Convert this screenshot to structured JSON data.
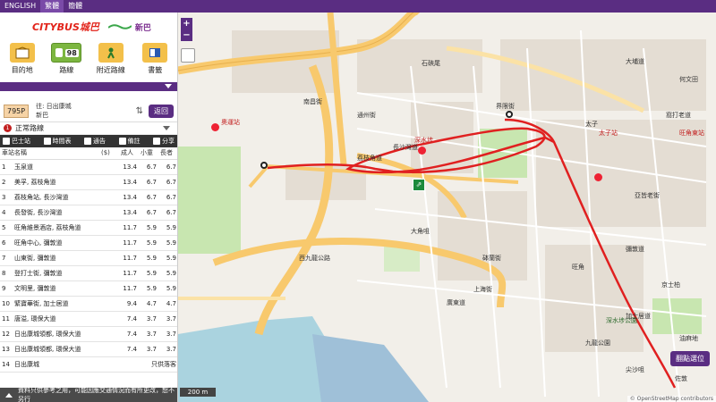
{
  "topbar": {
    "tabs": [
      "ENGLISH",
      "繁體",
      "簡體"
    ],
    "active": 1
  },
  "logos": {
    "citybus": "CITYBUS城巴",
    "nwfb": "新巴"
  },
  "nav": [
    {
      "label": "目的地",
      "icon": "destination-icon"
    },
    {
      "label": "路線",
      "icon": "bus-route-icon",
      "badge": "98"
    },
    {
      "label": "附近路線",
      "icon": "nearby-routes-icon"
    },
    {
      "label": "書籤",
      "icon": "bookmark-icon"
    }
  ],
  "route": {
    "number": "795P",
    "dest_line1": "往: 日出康城",
    "dest_line2": "新巴",
    "back": "返回"
  },
  "service": {
    "num": "1",
    "label": "正常路線"
  },
  "toolbar": {
    "stop": "巴士站",
    "timetable": "時間表",
    "notice": "通告",
    "remark": "備註",
    "share": "分享"
  },
  "table": {
    "headers": [
      "車站名稱",
      "($)",
      "成人",
      "小童",
      "長者"
    ],
    "rows": [
      {
        "n": "1",
        "name": "玉泉道",
        "a": "13.4",
        "c": "6.7",
        "s": "6.7"
      },
      {
        "n": "2",
        "name": "美孚, 荔枝角道",
        "a": "13.4",
        "c": "6.7",
        "s": "6.7"
      },
      {
        "n": "3",
        "name": "荔枝角站, 長沙灣道",
        "a": "13.4",
        "c": "6.7",
        "s": "6.7"
      },
      {
        "n": "4",
        "name": "長發街, 長沙灣道",
        "a": "13.4",
        "c": "6.7",
        "s": "6.7"
      },
      {
        "n": "5",
        "name": "旺角維景酒店, 荔枝角道",
        "a": "11.7",
        "c": "5.9",
        "s": "5.9"
      },
      {
        "n": "6",
        "name": "旺角中心, 彌敦道",
        "a": "11.7",
        "c": "5.9",
        "s": "5.9"
      },
      {
        "n": "7",
        "name": "山東街, 彌敦道",
        "a": "11.7",
        "c": "5.9",
        "s": "5.9"
      },
      {
        "n": "8",
        "name": "登打士街, 彌敦道",
        "a": "11.7",
        "c": "5.9",
        "s": "5.9"
      },
      {
        "n": "9",
        "name": "文明里, 彌敦道",
        "a": "11.7",
        "c": "5.9",
        "s": "5.9"
      },
      {
        "n": "10",
        "name": "緊寶華街, 加士居道",
        "a": "9.4",
        "c": "4.7",
        "s": "4.7"
      },
      {
        "n": "11",
        "name": "唐溢, 環保大道",
        "a": "7.4",
        "c": "3.7",
        "s": "3.7"
      },
      {
        "n": "12",
        "name": "日出康城領都, 環保大道",
        "a": "7.4",
        "c": "3.7",
        "s": "3.7"
      },
      {
        "n": "13",
        "name": "日出康城領都, 環保大道",
        "a": "7.4",
        "c": "3.7",
        "s": "3.7"
      },
      {
        "n": "14",
        "name": "日出康城",
        "a": "",
        "c": "",
        "s": "",
        "note": "只供落客"
      }
    ]
  },
  "disclaimer": "資料只供參考之用，可能因應交通情況而有所更改，恕不另行",
  "map": {
    "scale": "200 m",
    "jump": "翻點選位",
    "copyright": "© OpenStreetMap contributors",
    "labels": [
      "石硤尾",
      "南昌街",
      "大埔道",
      "界限街",
      "通州街",
      "長沙灣道",
      "荔枝角道",
      "深水埗",
      "大角咀",
      "旺角",
      "彌敦道",
      "太子",
      "亞皆老街",
      "油麻地",
      "佐敦",
      "西九龍公路",
      "旺角東站",
      "九龍公園",
      "京士柏",
      "尖沙咀",
      "上海街",
      "深水埗公園",
      "太子站",
      "奧運站",
      "砵蘭街",
      "廣東道",
      "何文田",
      "加士居道",
      "窩打老道"
    ]
  },
  "colors": {
    "brand": "#5a2d82",
    "route": "#e02020",
    "green": "#1c8a3c"
  }
}
